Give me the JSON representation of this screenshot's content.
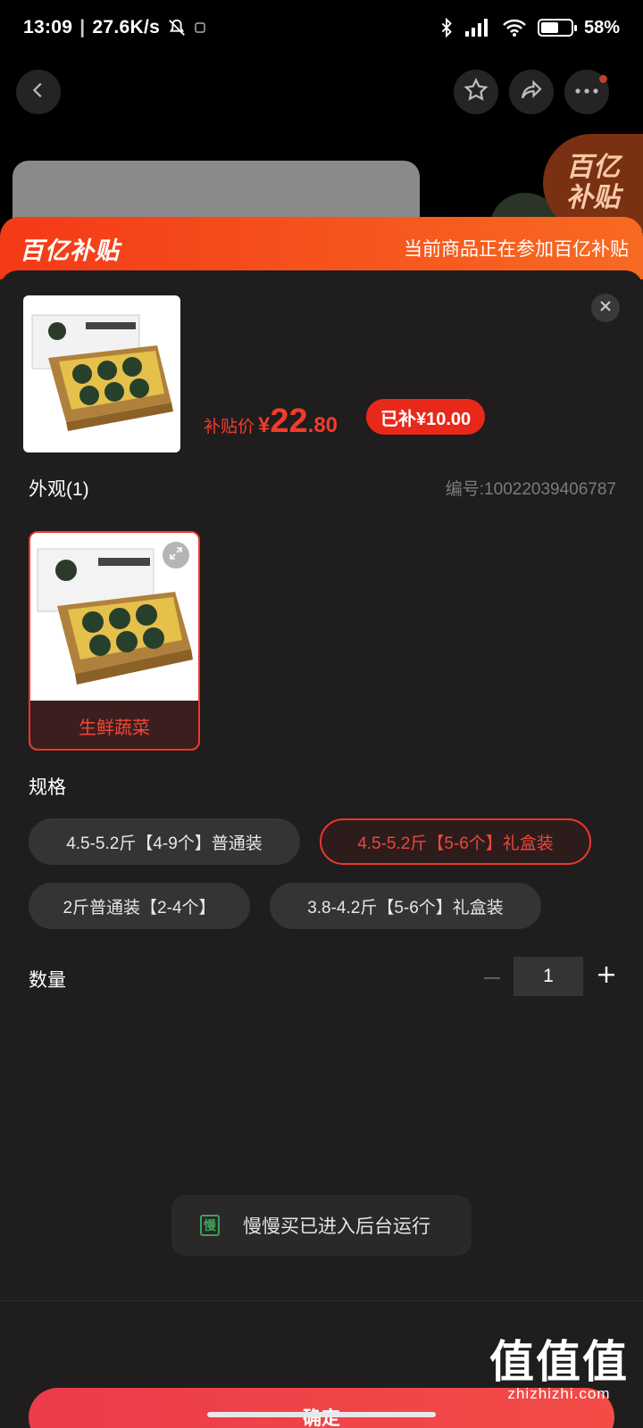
{
  "status_bar": {
    "time": "13:09",
    "net_speed": "27.6K/s",
    "battery": "58%",
    "battery_level": 0.58
  },
  "nav": {
    "back_icon": "back-arrow-icon",
    "favorite_icon": "star-icon",
    "share_icon": "share-icon",
    "more_icon": "more-dots-icon"
  },
  "promo_badge": {
    "line1": "百亿",
    "line2": "补贴"
  },
  "banner": {
    "logo": "百亿补贴",
    "text": "当前商品正在参加百亿补贴"
  },
  "product": {
    "price_label": "补贴价",
    "currency": "¥",
    "price_int": "22",
    "price_dec": ".80",
    "subsidy": "已补¥10.00"
  },
  "appearance": {
    "title": "外观(1)",
    "sku_code": "编号:10022039406787",
    "options": [
      {
        "label": "生鲜蔬菜",
        "selected": true
      }
    ]
  },
  "spec": {
    "title": "规格",
    "options": [
      {
        "label": "4.5-5.2斤【4-9个】普通装",
        "selected": false
      },
      {
        "label": "4.5-5.2斤【5-6个】礼盒装",
        "selected": true
      },
      {
        "label": "2斤普通装【2-4个】",
        "selected": false
      },
      {
        "label": "3.8-4.2斤【5-6个】礼盒装",
        "selected": false
      }
    ]
  },
  "quantity": {
    "title": "数量",
    "value": "1",
    "minus": "−",
    "plus": "+"
  },
  "toast": {
    "text": "慢慢买已进入后台运行"
  },
  "confirm": {
    "label": "确定"
  },
  "watermark": {
    "big": "值值值",
    "small": "zhizhizhi.com"
  },
  "colors": {
    "accent": "#f0362a",
    "banner_start": "#f43a17",
    "banner_end": "#f86a22",
    "sheet_bg": "#1f1d1e",
    "chip_bg": "#353334"
  }
}
